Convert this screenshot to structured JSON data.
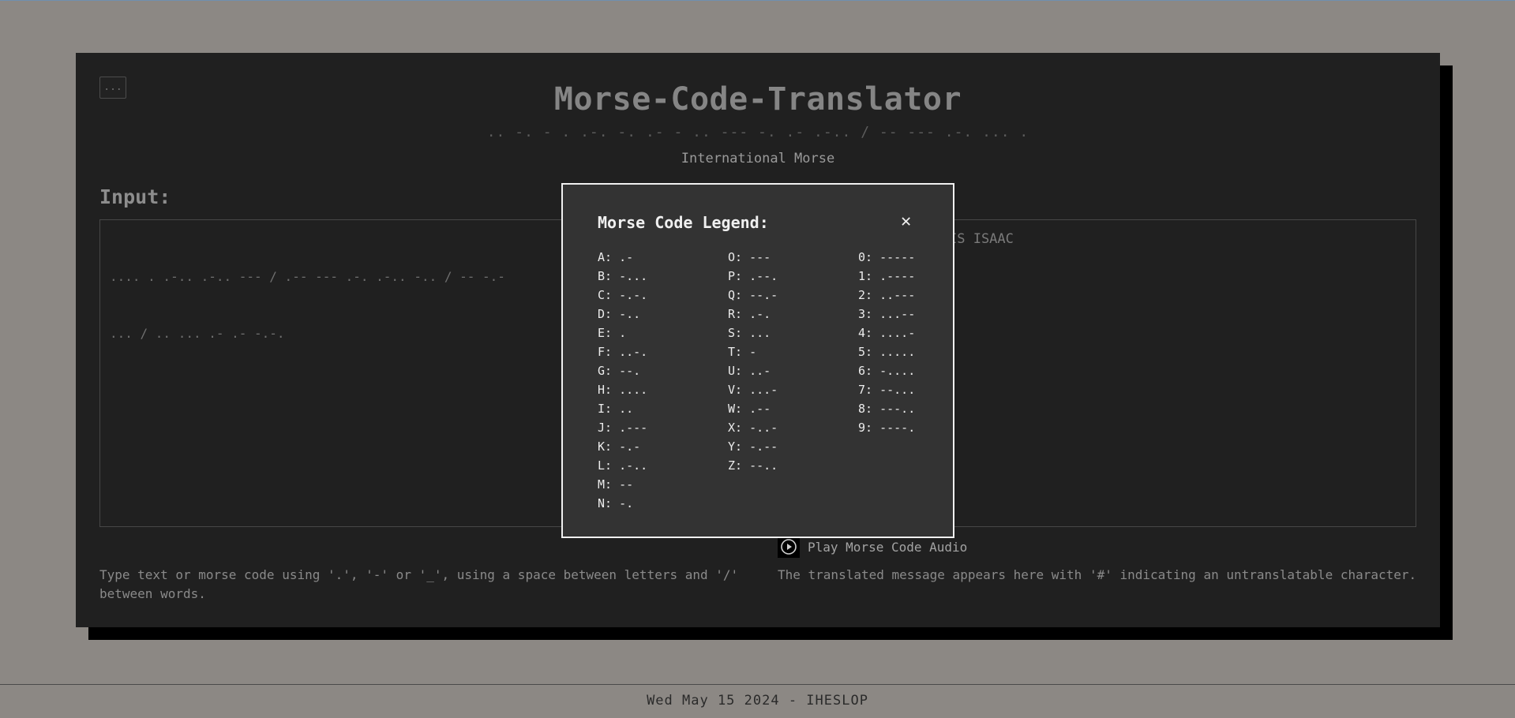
{
  "app": {
    "menu_button": "...",
    "title": "Morse-Code-Translator",
    "title_morse": ".. -. - . .-. -. .- - .. --- -. .- .-.. / -- --- .-. ... .",
    "subtitle": "International Morse"
  },
  "input": {
    "heading": "Input:",
    "value": ".... . .-.. .-.. --- / .-- --- .-. .-.. -.. / -- -.-- / -. .- -- . / .. ... / .. ... .- .- -.-.",
    "visible_line1": ".... . .-.. .-.. --- / .-- --- .-. .-.. -.. / -- -.-",
    "visible_line2": "... / .. ... .- .- -.-.",
    "hint": "Type text or morse code using '.', '-' or '_', using a space between letters and '/' between words."
  },
  "output": {
    "visible_value": "IS ISAAC",
    "play_label": "Play Morse Code Audio",
    "hint": "The translated message appears here with '#' indicating an untranslatable character."
  },
  "legend": {
    "title": "Morse Code Legend:",
    "close_icon": "close-icon",
    "close_glyph": "✕",
    "col1": [
      "A: .-",
      "B: -...",
      "C: -.-.",
      "D: -..",
      "E: .",
      "F: ..-.",
      "G: --.",
      "H: ....",
      "I: ..",
      "J: .---",
      "K: -.-",
      "L: .-..",
      "M: --",
      "N: -."
    ],
    "col2": [
      "O: ---",
      "P: .--.",
      "Q: --.-",
      "R: .-.",
      "S: ...",
      "T: -",
      "U: ..-",
      "V: ...-",
      "W: .--",
      "X: -..-",
      "Y: -.--",
      "Z: --.."
    ],
    "col3": [
      "0: -----",
      "1: .----",
      "2: ..---",
      "3: ...--",
      "4: ....-",
      "5: .....",
      "6: -....",
      "7: --...",
      "8: ---..",
      "9: ----."
    ]
  },
  "footer": {
    "text": "Wed May 15 2024 - IHESLOP"
  },
  "colors": {
    "page_background": "#8c8884",
    "card_background": "#202020",
    "modal_background": "#333333",
    "modal_border": "#f0f0f0"
  }
}
